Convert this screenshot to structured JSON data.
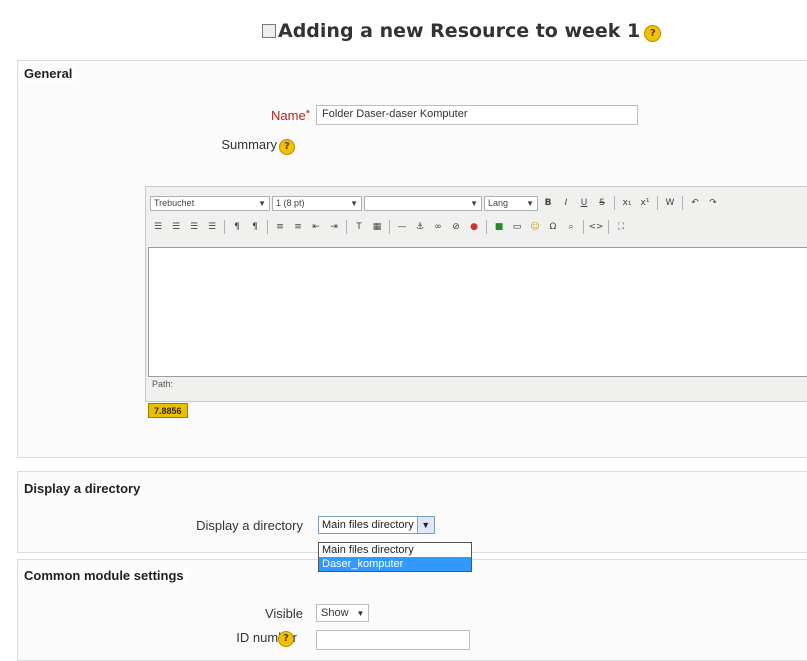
{
  "header": {
    "title": "Adding a new Resource to week 1",
    "resource_icon": "resource-icon",
    "help_icon": "help-icon"
  },
  "general": {
    "legend": "General",
    "name_label": "Name",
    "name_required": "*",
    "name_value": "Folder Daser-daser Komputer",
    "summary_label": "Summary",
    "editor": {
      "font_family": "Trebuchet",
      "font_size": "1 (8 pt)",
      "format": "",
      "lang": "Lang",
      "path_label": "Path:",
      "badge": "7.8856"
    }
  },
  "display": {
    "legend": "Display a directory",
    "label": "Display a directory",
    "selected": "Main files directory",
    "options": [
      "Main files directory",
      "Daser_komputer"
    ],
    "highlighted_index": 1
  },
  "common": {
    "legend": "Common module settings",
    "visible_label": "Visible",
    "visible_value": "Show",
    "idnumber_label": "ID number"
  },
  "colors": {
    "accent": "#3399ff",
    "required": "#b5231f",
    "help": "#f2c200"
  }
}
